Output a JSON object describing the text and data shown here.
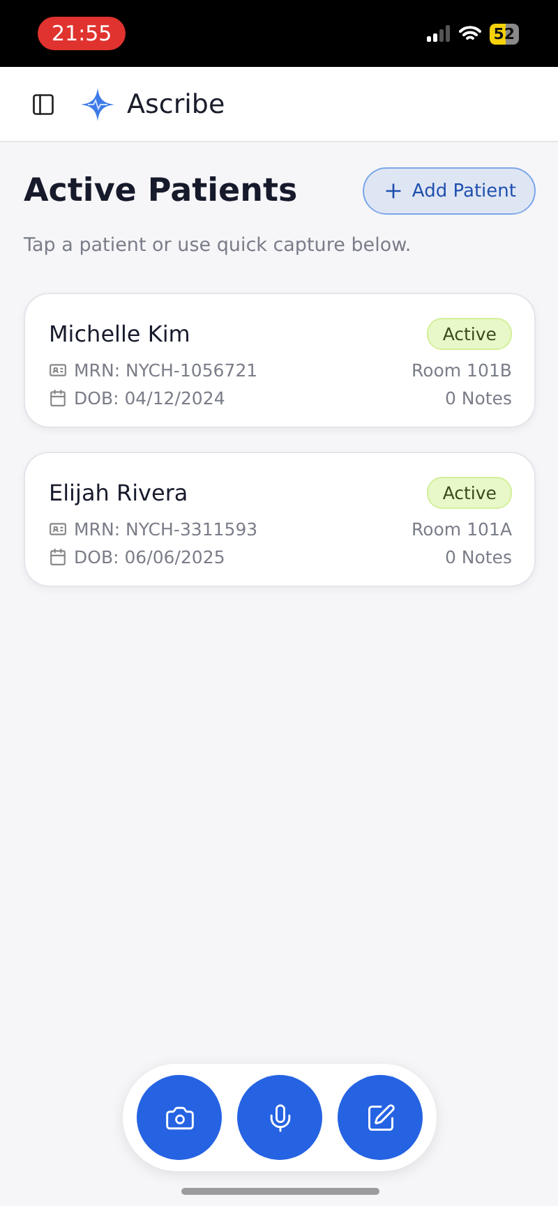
{
  "status_bar": {
    "time": "21:55",
    "recording": true,
    "battery": "52",
    "low_power": true
  },
  "header": {
    "app_name": "Ascribe"
  },
  "page": {
    "title": "Active Patients",
    "subtitle": "Tap a patient or use quick capture below.",
    "add_button": "Add Patient"
  },
  "patients": [
    {
      "name": "Michelle Kim",
      "status": {
        "label": "Active",
        "kind": "active"
      },
      "mrn": "MRN: NYCH-1056721",
      "dob": "DOB: 04/12/2024",
      "room": "Room 101B",
      "notes": "0 Notes"
    },
    {
      "name": "Elijah Rivera",
      "status": {
        "label": "Active",
        "kind": "active"
      },
      "mrn": "MRN: NYCH-3311593",
      "dob": "DOB: 06/06/2025",
      "room": "Room 101A",
      "notes": "0 Notes"
    }
  ],
  "quick_capture": [
    {
      "kind": "camera"
    },
    {
      "kind": "voice"
    },
    {
      "kind": "note"
    }
  ]
}
